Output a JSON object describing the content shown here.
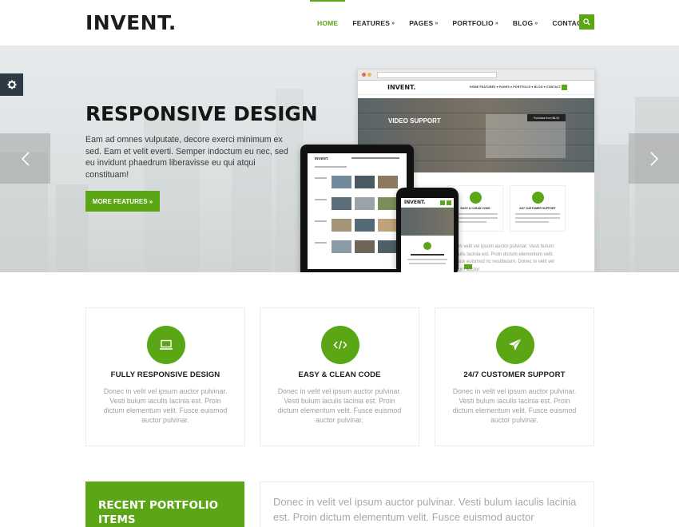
{
  "header": {
    "logo": "INVENT.",
    "nav": [
      {
        "label": "HOME",
        "active": true,
        "dropdown": false
      },
      {
        "label": "FEATURES",
        "active": false,
        "dropdown": true
      },
      {
        "label": "PAGES",
        "active": false,
        "dropdown": true
      },
      {
        "label": "PORTFOLIO",
        "active": false,
        "dropdown": true
      },
      {
        "label": "BLOG",
        "active": false,
        "dropdown": true
      },
      {
        "label": "CONTACT",
        "active": false,
        "dropdown": true
      }
    ],
    "search_icon": "search-icon",
    "dropdown_glyph": "»"
  },
  "hero": {
    "title": "RESPONSIVE DESIGN",
    "text": "Eam ad omnes vulputate, decore exerci minimum ex sed. Eam et velit everti. Semper indoctum eu nec, sed eu invidunt phaedrum liberavisse eu qui atqui constituam!",
    "button_label": "MORE FEATURES  »",
    "settings_icon": "gear-icon",
    "prev_icon": "chevron-left-icon",
    "next_icon": "chevron-right-icon",
    "mockup": {
      "laptop_logo": "INVENT.",
      "laptop_nav": "HOME  FEATURES ▾  PAGES ▾  PORTFOLIO ▾  BLOG ▾  CONTACT ▾",
      "video_title": "VIDEO SUPPORT",
      "purchase_chip": "Purchase from $6.00",
      "card_1_title": "EASY & CLEAN CODE",
      "card_2_title": "24/7 CUSTOMER SUPPORT",
      "laptop_text": "nc in velit vel ipsum auctor pulvinar. Vesti bulum iaculis lacinia est. Proin dictum elementum velit. Fusce euismod nc vestibulum. Donec in velit vel ipsum auctor",
      "tablet_logo": "INVENT.",
      "phone_logo": "INVENT."
    }
  },
  "features": [
    {
      "title": "FULLY RESPONSIVE DESIGN",
      "text": "Donec in velit vel ipsum auctor pulvinar. Vesti bulum iaculis lacinia est. Proin dictum elementum velit. Fusce euismod auctor pulvinar.",
      "icon": "laptop-icon"
    },
    {
      "title": "EASY & CLEAN CODE",
      "text": "Donec in velit vel ipsum auctor pulvinar. Vesti bulum iaculis lacinia est. Proin dictum elementum velit. Fusce euismod auctor pulvinar.",
      "icon": "code-icon"
    },
    {
      "title": "24/7 CUSTOMER SUPPORT",
      "text": "Donec in velit vel ipsum auctor pulvinar. Vesti bulum iaculis lacinia est. Proin dictum elementum velit. Fusce euismod auctor pulvinar.",
      "icon": "paper-plane-icon"
    }
  ],
  "portfolio": {
    "title": "RECENT PORTFOLIO ITEMS",
    "intro": "Donec in velit vel ipsum auctor pulvinar. Vesti bulum iaculis lacinia est. Proin dictum elementum velit. Fusce euismod auctor"
  },
  "colors": {
    "accent": "#5aa614",
    "dark": "#1d1d1d",
    "muted_text": "#a0a0a0",
    "settings_tab": "#2d3a44"
  }
}
